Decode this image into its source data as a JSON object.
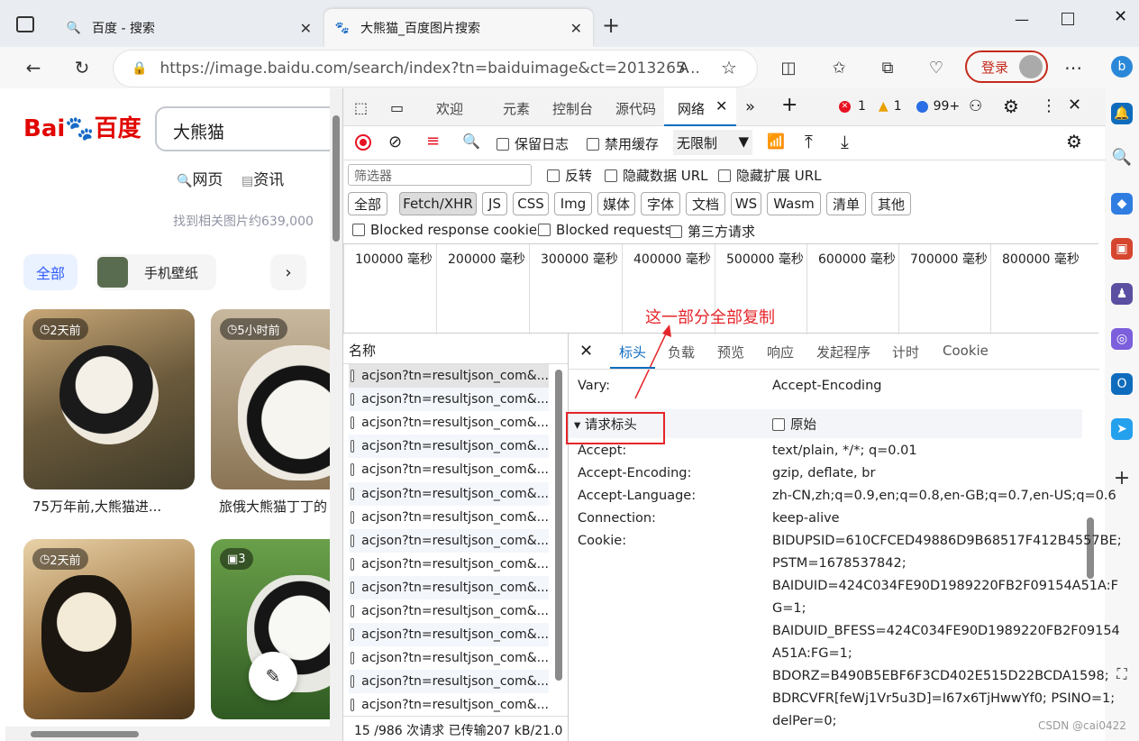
{
  "browser": {
    "tabs": [
      {
        "title": "百度 - 搜索"
      },
      {
        "title": "大熊猫_百度图片搜索"
      }
    ],
    "url": "https://image.baidu.com/search/index?tn=baiduimage&ct=2013265...",
    "login_label": "登录"
  },
  "page": {
    "search_value": "大熊猫",
    "search_tabs": [
      "网页",
      "资讯"
    ],
    "result_count": "找到相关图片约639,000",
    "chips": {
      "all": "全部",
      "wallpaper": "手机壁纸"
    },
    "cards": [
      {
        "badge": "2天前",
        "title": "75万年前,大熊猫进..."
      },
      {
        "badge": "5小时前",
        "title": "旅俄大熊猫丁丁的"
      },
      {
        "badge": "2天前",
        "title": ""
      },
      {
        "badge": "3",
        "title": ""
      }
    ]
  },
  "devtools": {
    "tabs": [
      "欢迎",
      "元素",
      "控制台",
      "源代码",
      "网络"
    ],
    "error_count": "1",
    "warning_count": "1",
    "info_count": "99+",
    "toolbar": {
      "preserve_log": "保留日志",
      "disable_cache": "禁用缓存",
      "throttle": "无限制"
    },
    "filter_placeholder": "筛选器",
    "filter_options": {
      "invert": "反转",
      "hide_data_url": "隐藏数据 URL",
      "hide_ext_url": "隐藏扩展 URL"
    },
    "type_filters": [
      "全部",
      "Fetch/XHR",
      "JS",
      "CSS",
      "Img",
      "媒体",
      "字体",
      "文档",
      "WS",
      "Wasm",
      "清单",
      "其他"
    ],
    "extra_filters": {
      "blocked_cookies": "Blocked response cookies",
      "blocked_requests": "Blocked requests",
      "third_party": "第三方请求"
    },
    "timeline_ticks": [
      "100000 毫秒",
      "200000 毫秒",
      "300000 毫秒",
      "400000 毫秒",
      "500000 毫秒",
      "600000 毫秒",
      "700000 毫秒",
      "800000 毫秒"
    ],
    "annotation": "这一部分全部复制",
    "request_list_header": "名称",
    "request_name": "acjson?tn=resultjson_com&...",
    "status_bar": "15 /986 次请求  已传输207 kB/21.0",
    "detail_tabs": [
      "标头",
      "负载",
      "预览",
      "响应",
      "发起程序",
      "计时",
      "Cookie"
    ],
    "vary": {
      "name": "Vary:",
      "value": "Accept-Encoding"
    },
    "section_title": "▾ 请求标头",
    "raw_label": "原始",
    "headers": [
      {
        "name": "Accept:",
        "value": "text/plain, */*; q=0.01"
      },
      {
        "name": "Accept-Encoding:",
        "value": "gzip, deflate, br"
      },
      {
        "name": "Accept-Language:",
        "value": "zh-CN,zh;q=0.9,en;q=0.8,en-GB;q=0.7,en-US;q=0.6"
      },
      {
        "name": "Connection:",
        "value": "keep-alive"
      },
      {
        "name": "Cookie:",
        "value": "BIDUPSID=610CFCED49886D9B68517F412B4557BE;"
      }
    ],
    "cookie_lines": [
      "PSTM=1678537842;",
      "BAIDUID=424C034FE90D1989220FB2F09154A51A:F",
      "G=1;",
      "BAIDUID_BFESS=424C034FE90D1989220FB2F09154",
      "A51A:FG=1;",
      "BDORZ=B490B5EBF6F3CD402E515D22BCDA1598;",
      "BDRCVFR[feWj1Vr5u3D]=I67x6TjHwwYf0; PSINO=1;",
      "delPer=0;"
    ]
  },
  "watermark": "CSDN @cai0422"
}
